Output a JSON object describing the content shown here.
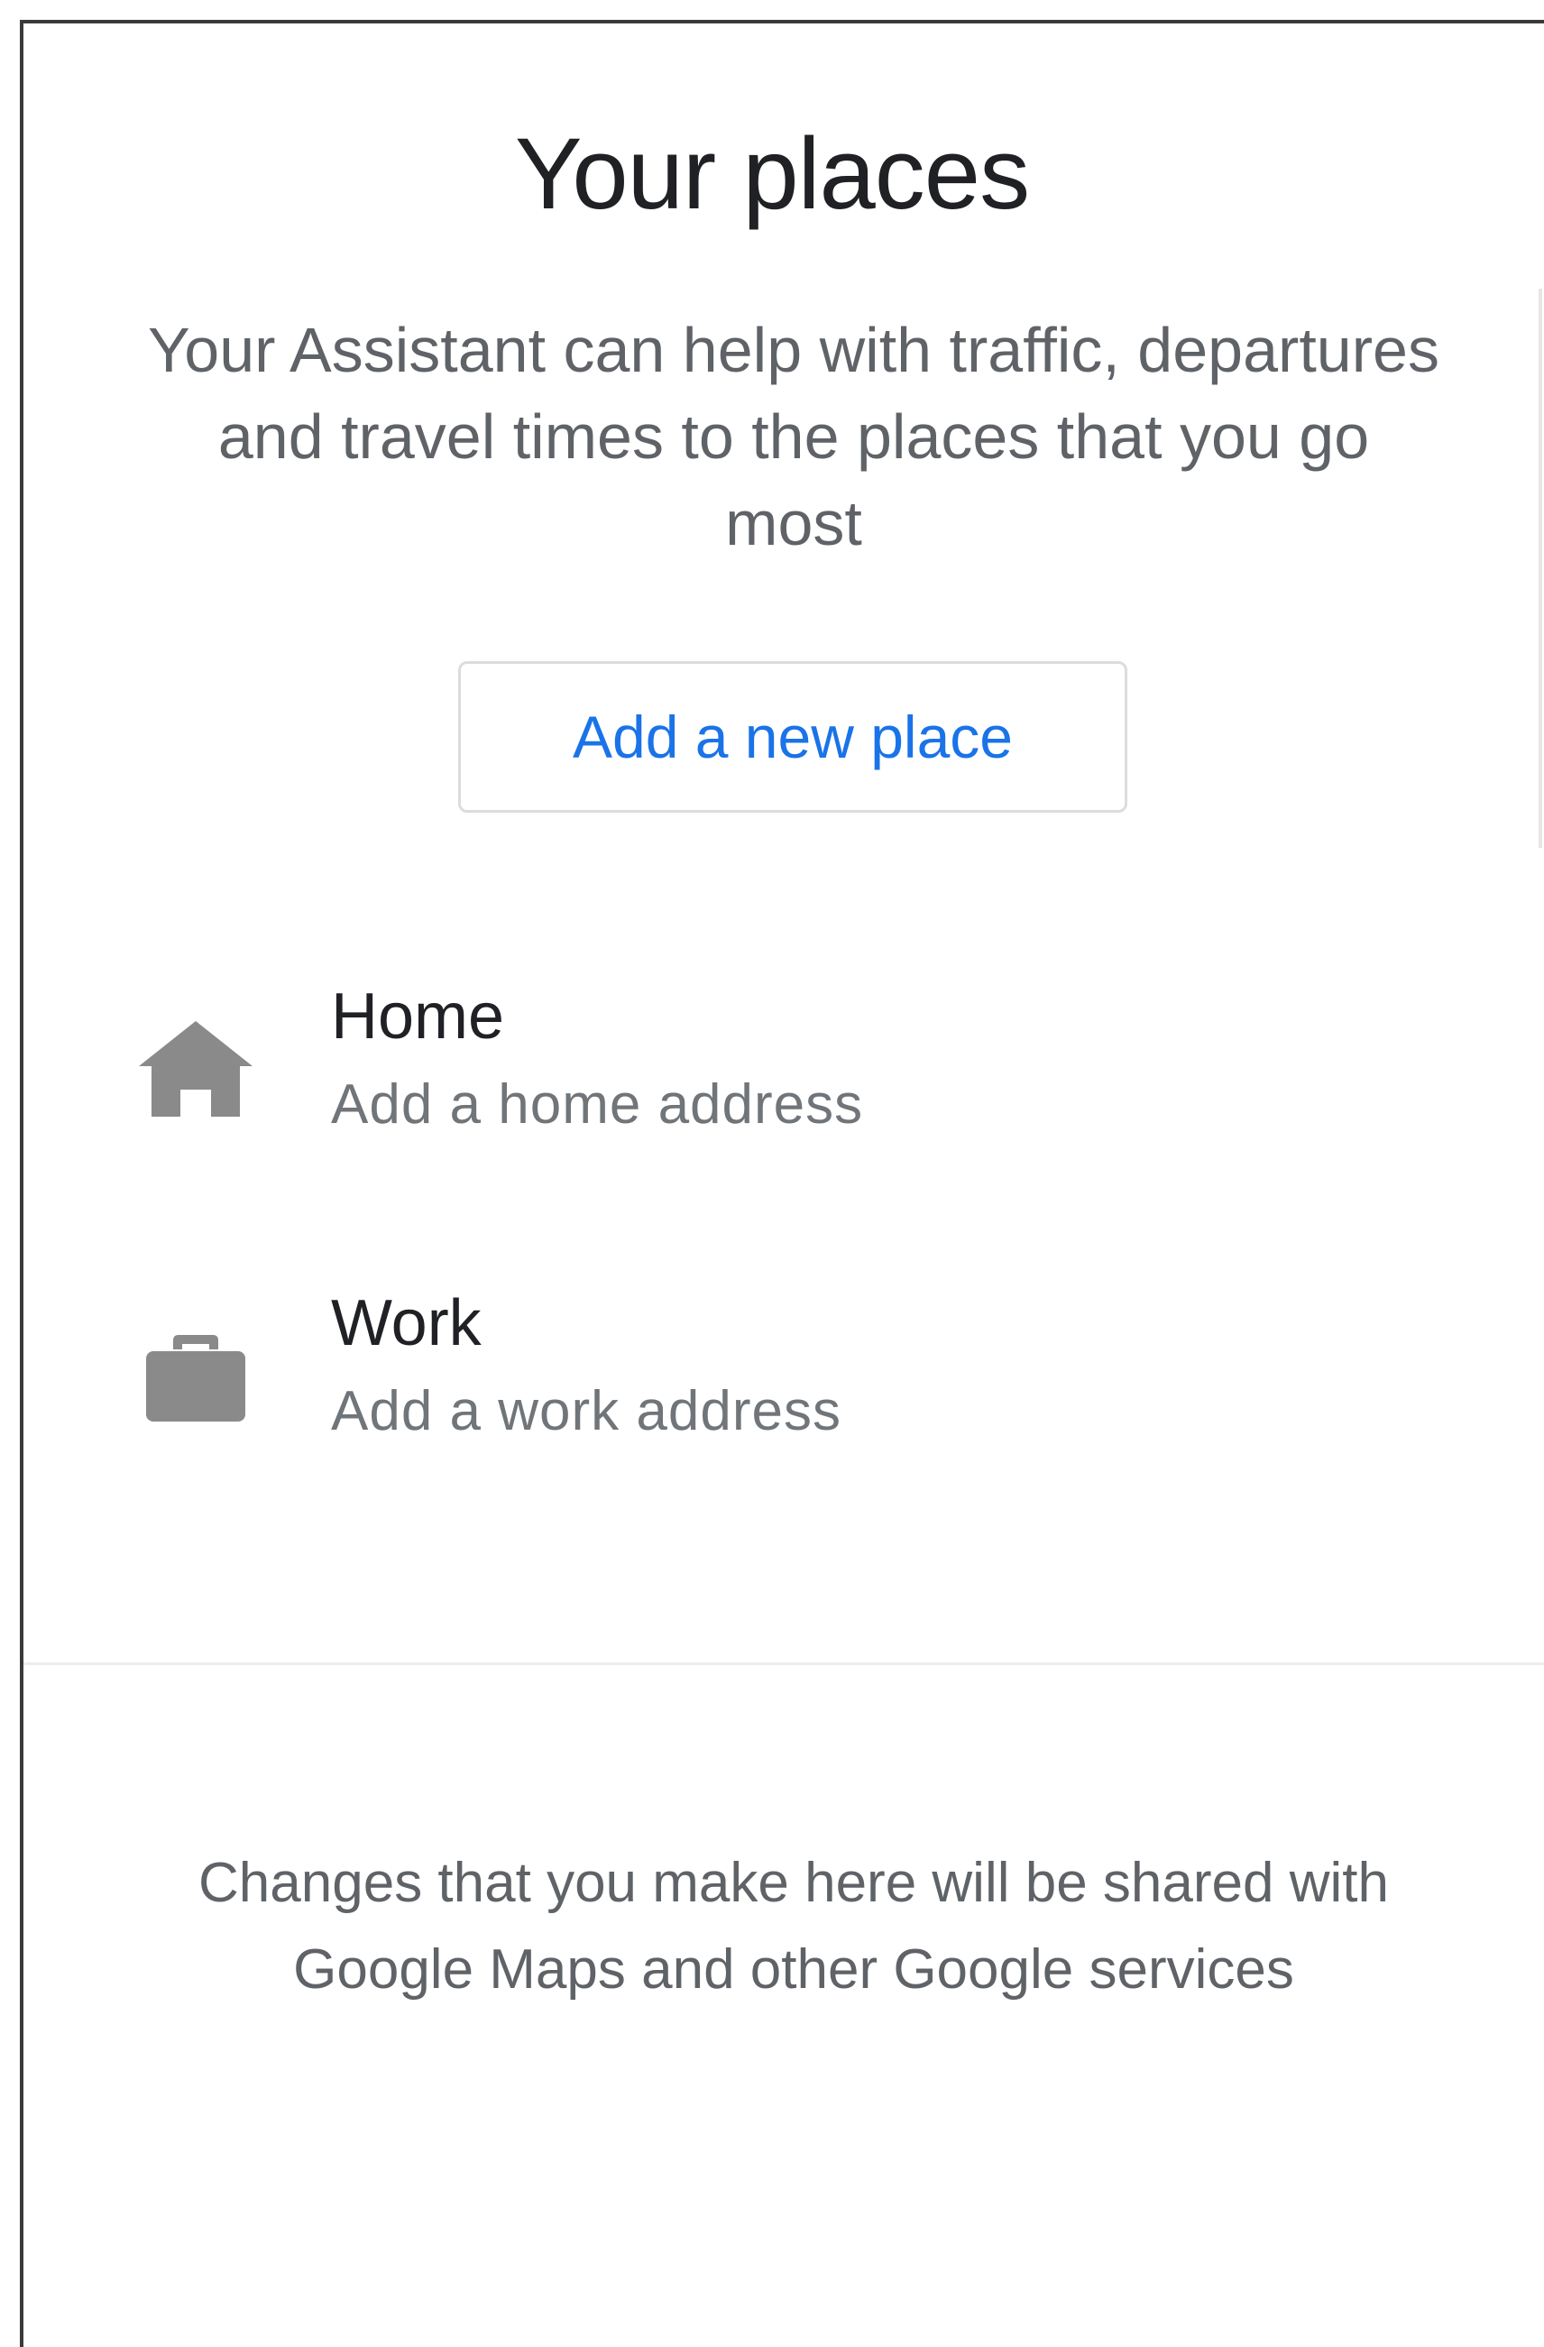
{
  "page": {
    "title": "Your places",
    "subtitle": "Your Assistant can help with traffic, departures and travel times to the places that you go most"
  },
  "actions": {
    "add_place_label": "Add a new place"
  },
  "places": [
    {
      "name": "Home",
      "subtitle": "Add a home address",
      "icon": "home-icon"
    },
    {
      "name": "Work",
      "subtitle": "Add a work address",
      "icon": "briefcase-icon"
    }
  ],
  "footer": {
    "note": "Changes that you make here will be shared with Google Maps and other Google services"
  },
  "colors": {
    "accent": "#1a73e8",
    "title_text": "#202124",
    "secondary_text": "#5f6368",
    "icon": "#8a8a8a"
  }
}
